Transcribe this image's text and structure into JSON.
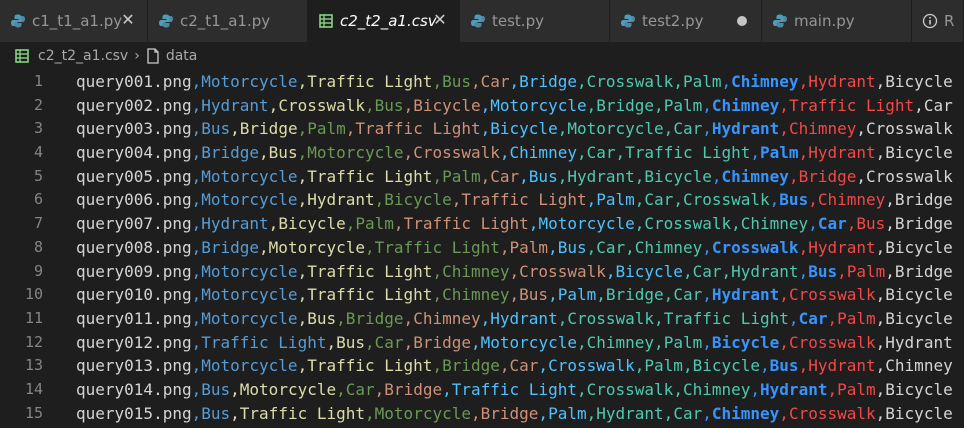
{
  "tabs": [
    {
      "label": "c1_t1_a1.py",
      "type": "py",
      "state": "close"
    },
    {
      "label": "c2_t1_a1.py",
      "type": "py",
      "state": "none"
    },
    {
      "label": "c2_t2_a1.csv",
      "type": "csv",
      "state": "close-active"
    },
    {
      "label": "test.py",
      "type": "py",
      "state": "none"
    },
    {
      "label": "test2.py",
      "type": "py",
      "state": "dirty"
    },
    {
      "label": "main.py",
      "type": "py",
      "state": "none"
    },
    {
      "label": "R",
      "type": "info",
      "state": "none"
    }
  ],
  "breadcrumb": {
    "file": "c2_t2_a1.csv",
    "section": "data"
  },
  "colors": {
    "col0": "#d4d4d4",
    "col1": "#569cd6",
    "col2": "#dcdcaa",
    "col3": "#6a9955",
    "col4": "#ce9178",
    "col5": "#4fc1ff",
    "col6": "#4ec9b0",
    "col7": "#4ec9b0",
    "col8": "#3794ff",
    "col9": "#f44747",
    "col10": "#d4d4d4",
    "py_icon": "#519aba",
    "csv_icon": "#89d185"
  },
  "lines": [
    {
      "n": "1",
      "cells": [
        "query001.png",
        "Motorcycle",
        "Traffic Light",
        "Bus",
        "Car",
        "Bridge",
        "Crosswalk",
        "Palm",
        "Chimney",
        "Hydrant",
        "Bicycle"
      ]
    },
    {
      "n": "2",
      "cells": [
        "query002.png",
        "Hydrant",
        "Crosswalk",
        "Bus",
        "Bicycle",
        "Motorcycle",
        "Bridge",
        "Palm",
        "Chimney",
        "Traffic Light",
        "Car"
      ]
    },
    {
      "n": "3",
      "cells": [
        "query003.png",
        "Bus",
        "Bridge",
        "Palm",
        "Traffic Light",
        "Bicycle",
        "Motorcycle",
        "Car",
        "Hydrant",
        "Chimney",
        "Crosswalk"
      ]
    },
    {
      "n": "4",
      "cells": [
        "query004.png",
        "Bridge",
        "Bus",
        "Motorcycle",
        "Crosswalk",
        "Chimney",
        "Car",
        "Traffic Light",
        "Palm",
        "Hydrant",
        "Bicycle"
      ]
    },
    {
      "n": "5",
      "cells": [
        "query005.png",
        "Motorcycle",
        "Traffic Light",
        "Palm",
        "Car",
        "Bus",
        "Hydrant",
        "Bicycle",
        "Chimney",
        "Bridge",
        "Crosswalk"
      ]
    },
    {
      "n": "6",
      "cells": [
        "query006.png",
        "Motorcycle",
        "Hydrant",
        "Bicycle",
        "Traffic Light",
        "Palm",
        "Car",
        "Crosswalk",
        "Bus",
        "Chimney",
        "Bridge"
      ]
    },
    {
      "n": "7",
      "cells": [
        "query007.png",
        "Hydrant",
        "Bicycle",
        "Palm",
        "Traffic Light",
        "Motorcycle",
        "Crosswalk",
        "Chimney",
        "Car",
        "Bus",
        "Bridge"
      ]
    },
    {
      "n": "8",
      "cells": [
        "query008.png",
        "Bridge",
        "Motorcycle",
        "Traffic Light",
        "Palm",
        "Bus",
        "Car",
        "Chimney",
        "Crosswalk",
        "Hydrant",
        "Bicycle"
      ]
    },
    {
      "n": "9",
      "cells": [
        "query009.png",
        "Motorcycle",
        "Traffic Light",
        "Chimney",
        "Crosswalk",
        "Bicycle",
        "Car",
        "Hydrant",
        "Bus",
        "Palm",
        "Bridge"
      ]
    },
    {
      "n": "10",
      "cells": [
        "query010.png",
        "Motorcycle",
        "Traffic Light",
        "Chimney",
        "Bus",
        "Palm",
        "Bridge",
        "Car",
        "Hydrant",
        "Crosswalk",
        "Bicycle"
      ]
    },
    {
      "n": "11",
      "cells": [
        "query011.png",
        "Motorcycle",
        "Bus",
        "Bridge",
        "Chimney",
        "Hydrant",
        "Crosswalk",
        "Traffic Light",
        "Car",
        "Palm",
        "Bicycle"
      ]
    },
    {
      "n": "12",
      "cells": [
        "query012.png",
        "Traffic Light",
        "Bus",
        "Car",
        "Bridge",
        "Motorcycle",
        "Chimney",
        "Palm",
        "Bicycle",
        "Crosswalk",
        "Hydrant"
      ]
    },
    {
      "n": "13",
      "cells": [
        "query013.png",
        "Motorcycle",
        "Traffic Light",
        "Bridge",
        "Car",
        "Crosswalk",
        "Palm",
        "Bicycle",
        "Bus",
        "Hydrant",
        "Chimney"
      ]
    },
    {
      "n": "14",
      "cells": [
        "query014.png",
        "Bus",
        "Motorcycle",
        "Car",
        "Bridge",
        "Traffic Light",
        "Crosswalk",
        "Chimney",
        "Hydrant",
        "Palm",
        "Bicycle"
      ]
    },
    {
      "n": "15",
      "cells": [
        "query015.png",
        "Bus",
        "Traffic Light",
        "Motorcycle",
        "Bridge",
        "Palm",
        "Hydrant",
        "Car",
        "Chimney",
        "Crosswalk",
        "Bicycle"
      ]
    }
  ]
}
